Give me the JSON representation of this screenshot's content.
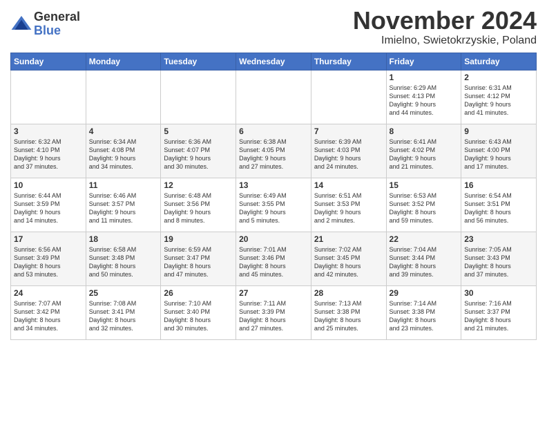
{
  "logo": {
    "general": "General",
    "blue": "Blue"
  },
  "title": "November 2024",
  "location": "Imielno, Swietokrzyskie, Poland",
  "headers": [
    "Sunday",
    "Monday",
    "Tuesday",
    "Wednesday",
    "Thursday",
    "Friday",
    "Saturday"
  ],
  "weeks": [
    [
      {
        "day": "",
        "info": ""
      },
      {
        "day": "",
        "info": ""
      },
      {
        "day": "",
        "info": ""
      },
      {
        "day": "",
        "info": ""
      },
      {
        "day": "",
        "info": ""
      },
      {
        "day": "1",
        "info": "Sunrise: 6:29 AM\nSunset: 4:13 PM\nDaylight: 9 hours\nand 44 minutes."
      },
      {
        "day": "2",
        "info": "Sunrise: 6:31 AM\nSunset: 4:12 PM\nDaylight: 9 hours\nand 41 minutes."
      }
    ],
    [
      {
        "day": "3",
        "info": "Sunrise: 6:32 AM\nSunset: 4:10 PM\nDaylight: 9 hours\nand 37 minutes."
      },
      {
        "day": "4",
        "info": "Sunrise: 6:34 AM\nSunset: 4:08 PM\nDaylight: 9 hours\nand 34 minutes."
      },
      {
        "day": "5",
        "info": "Sunrise: 6:36 AM\nSunset: 4:07 PM\nDaylight: 9 hours\nand 30 minutes."
      },
      {
        "day": "6",
        "info": "Sunrise: 6:38 AM\nSunset: 4:05 PM\nDaylight: 9 hours\nand 27 minutes."
      },
      {
        "day": "7",
        "info": "Sunrise: 6:39 AM\nSunset: 4:03 PM\nDaylight: 9 hours\nand 24 minutes."
      },
      {
        "day": "8",
        "info": "Sunrise: 6:41 AM\nSunset: 4:02 PM\nDaylight: 9 hours\nand 21 minutes."
      },
      {
        "day": "9",
        "info": "Sunrise: 6:43 AM\nSunset: 4:00 PM\nDaylight: 9 hours\nand 17 minutes."
      }
    ],
    [
      {
        "day": "10",
        "info": "Sunrise: 6:44 AM\nSunset: 3:59 PM\nDaylight: 9 hours\nand 14 minutes."
      },
      {
        "day": "11",
        "info": "Sunrise: 6:46 AM\nSunset: 3:57 PM\nDaylight: 9 hours\nand 11 minutes."
      },
      {
        "day": "12",
        "info": "Sunrise: 6:48 AM\nSunset: 3:56 PM\nDaylight: 9 hours\nand 8 minutes."
      },
      {
        "day": "13",
        "info": "Sunrise: 6:49 AM\nSunset: 3:55 PM\nDaylight: 9 hours\nand 5 minutes."
      },
      {
        "day": "14",
        "info": "Sunrise: 6:51 AM\nSunset: 3:53 PM\nDaylight: 9 hours\nand 2 minutes."
      },
      {
        "day": "15",
        "info": "Sunrise: 6:53 AM\nSunset: 3:52 PM\nDaylight: 8 hours\nand 59 minutes."
      },
      {
        "day": "16",
        "info": "Sunrise: 6:54 AM\nSunset: 3:51 PM\nDaylight: 8 hours\nand 56 minutes."
      }
    ],
    [
      {
        "day": "17",
        "info": "Sunrise: 6:56 AM\nSunset: 3:49 PM\nDaylight: 8 hours\nand 53 minutes."
      },
      {
        "day": "18",
        "info": "Sunrise: 6:58 AM\nSunset: 3:48 PM\nDaylight: 8 hours\nand 50 minutes."
      },
      {
        "day": "19",
        "info": "Sunrise: 6:59 AM\nSunset: 3:47 PM\nDaylight: 8 hours\nand 47 minutes."
      },
      {
        "day": "20",
        "info": "Sunrise: 7:01 AM\nSunset: 3:46 PM\nDaylight: 8 hours\nand 45 minutes."
      },
      {
        "day": "21",
        "info": "Sunrise: 7:02 AM\nSunset: 3:45 PM\nDaylight: 8 hours\nand 42 minutes."
      },
      {
        "day": "22",
        "info": "Sunrise: 7:04 AM\nSunset: 3:44 PM\nDaylight: 8 hours\nand 39 minutes."
      },
      {
        "day": "23",
        "info": "Sunrise: 7:05 AM\nSunset: 3:43 PM\nDaylight: 8 hours\nand 37 minutes."
      }
    ],
    [
      {
        "day": "24",
        "info": "Sunrise: 7:07 AM\nSunset: 3:42 PM\nDaylight: 8 hours\nand 34 minutes."
      },
      {
        "day": "25",
        "info": "Sunrise: 7:08 AM\nSunset: 3:41 PM\nDaylight: 8 hours\nand 32 minutes."
      },
      {
        "day": "26",
        "info": "Sunrise: 7:10 AM\nSunset: 3:40 PM\nDaylight: 8 hours\nand 30 minutes."
      },
      {
        "day": "27",
        "info": "Sunrise: 7:11 AM\nSunset: 3:39 PM\nDaylight: 8 hours\nand 27 minutes."
      },
      {
        "day": "28",
        "info": "Sunrise: 7:13 AM\nSunset: 3:38 PM\nDaylight: 8 hours\nand 25 minutes."
      },
      {
        "day": "29",
        "info": "Sunrise: 7:14 AM\nSunset: 3:38 PM\nDaylight: 8 hours\nand 23 minutes."
      },
      {
        "day": "30",
        "info": "Sunrise: 7:16 AM\nSunset: 3:37 PM\nDaylight: 8 hours\nand 21 minutes."
      }
    ]
  ]
}
